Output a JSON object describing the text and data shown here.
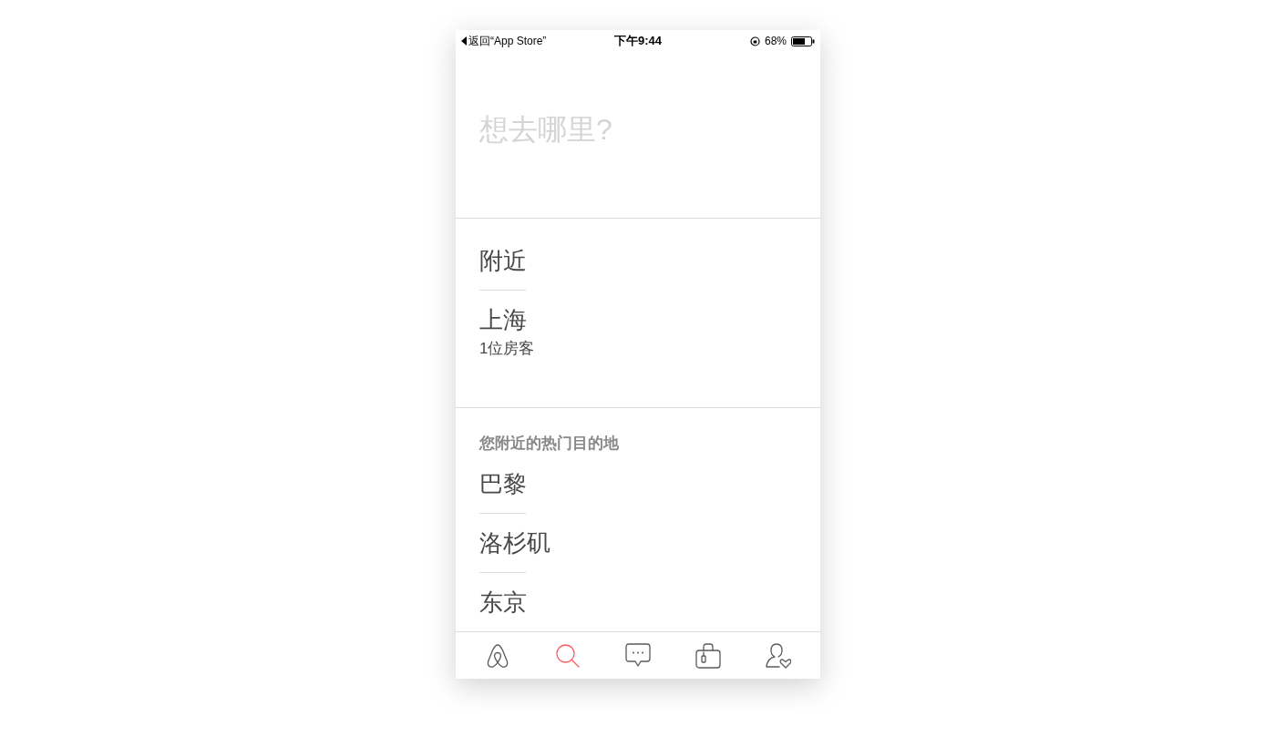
{
  "status_bar": {
    "back": "返回“App Store”",
    "time": "下午9:44",
    "battery": "68%"
  },
  "search": {
    "placeholder": "想去哪里?"
  },
  "recent": [
    {
      "title": "附近"
    },
    {
      "title": "上海",
      "subtitle": "1位房客"
    }
  ],
  "popular": {
    "heading": "您附近的热门目的地",
    "items": [
      "巴黎",
      "洛杉矶",
      "东京"
    ]
  },
  "tab_bar": [
    {
      "kind": "home",
      "selected": false
    },
    {
      "kind": "search",
      "selected": true
    },
    {
      "kind": "messages",
      "selected": false
    },
    {
      "kind": "trips",
      "selected": false
    },
    {
      "kind": "profile",
      "selected": false
    }
  ]
}
